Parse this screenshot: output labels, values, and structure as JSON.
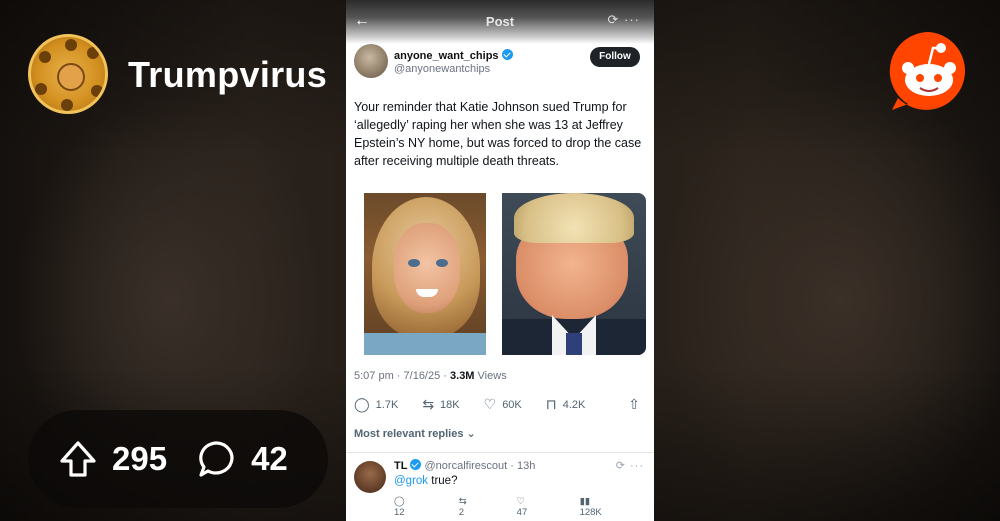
{
  "subreddit": {
    "name": "Trumpvirus"
  },
  "stats": {
    "upvotes": "295",
    "comments": "42"
  },
  "tweet": {
    "topbar_title": "Post",
    "author_name": "anyone_want_chips",
    "author_handle": "@anyonewantchips",
    "follow_label": "Follow",
    "text": "Your reminder that Katie Johnson sued Trump for ‘allegedly’ raping her when she was 13 at Jeffrey Epstein’s NY home, but was forced to drop the case after receiving multiple death threats.",
    "timestamp": "5:07 pm · 7/16/25 ·",
    "views_count": "3.3M",
    "views_label": "Views",
    "replies": "1.7K",
    "reposts": "18K",
    "likes": "60K",
    "bookmarks": "4.2K",
    "most_relevant_label": "Most relevant replies"
  },
  "reply": {
    "name": "TL",
    "handle": "@norcalfirescout",
    "time": "· 13h",
    "mention": "@grok",
    "text": "true?",
    "replies": "12",
    "reposts": "2",
    "likes": "47",
    "views": "128K"
  },
  "colors": {
    "reddit_orange": "#ff4500",
    "verified_blue": "#1d9bf0"
  }
}
